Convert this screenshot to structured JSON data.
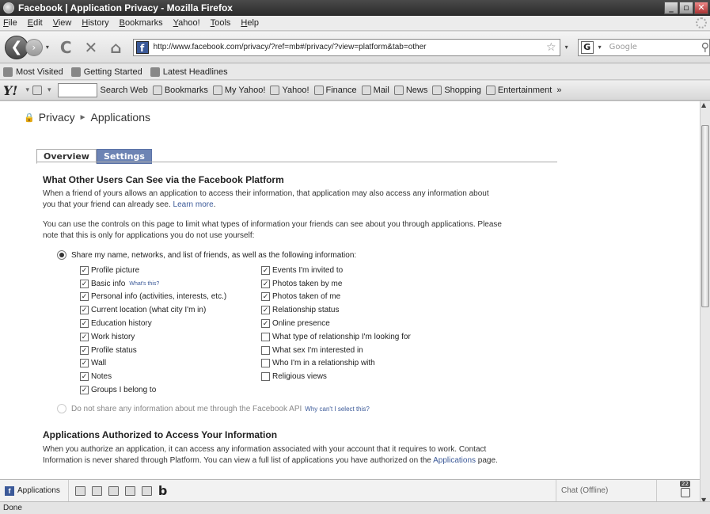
{
  "window": {
    "title": "Facebook | Application Privacy - Mozilla Firefox",
    "btn_min": "_",
    "btn_max": "▫",
    "btn_close": "✕"
  },
  "menu": [
    "File",
    "Edit",
    "View",
    "History",
    "Bookmarks",
    "Yahoo!",
    "Tools",
    "Help"
  ],
  "nav": {
    "url": "http://www.facebook.com/privacy/?ref=mb#/privacy/?view=platform&tab=other",
    "search_placeholder": "Google",
    "search_engine": "G",
    "fb_icon": "f",
    "back": "❮",
    "fwd": "›",
    "reload": "C",
    "stop": "✕",
    "home": "⌂",
    "star": "☆",
    "dropdown": "▾",
    "search_glass": "⚲"
  },
  "bookmarks": [
    "Most Visited",
    "Getting Started",
    "Latest Headlines"
  ],
  "yahoo": {
    "logo": "Y!",
    "search_web": "Search Web",
    "items": [
      "Bookmarks",
      "My Yahoo!",
      "Yahoo!",
      "Finance",
      "Mail",
      "News",
      "Shopping",
      "Entertainment"
    ],
    "more": "»"
  },
  "page": {
    "lock": "🔒",
    "breadcrumb": {
      "root": "Privacy",
      "sep": "►",
      "current": "Applications"
    },
    "tabs": [
      "Overview",
      "Settings"
    ],
    "section1": {
      "heading": "What Other Users Can See via the Facebook Platform",
      "para1": "When a friend of yours allows an application to access their information, that application may also access any information about you that your friend can already see.",
      "learn_more": "Learn more",
      "para2": "You can use the controls on this page to limit what types of information your friends can see about you through applications. Please note that this is only for applications you do not use yourself:",
      "share_label": "Share my name, networks, and list of friends, as well as the following information:",
      "left_options": [
        {
          "label": "Profile picture",
          "checked": true
        },
        {
          "label": "Basic info",
          "checked": true,
          "extra": "What's this?"
        },
        {
          "label": "Personal info (activities, interests, etc.)",
          "checked": true
        },
        {
          "label": "Current location (what city I'm in)",
          "checked": true
        },
        {
          "label": "Education history",
          "checked": true
        },
        {
          "label": "Work history",
          "checked": true
        },
        {
          "label": "Profile status",
          "checked": true
        },
        {
          "label": "Wall",
          "checked": true
        },
        {
          "label": "Notes",
          "checked": true
        },
        {
          "label": "Groups I belong to",
          "checked": true
        }
      ],
      "right_options": [
        {
          "label": "Events I'm invited to",
          "checked": true
        },
        {
          "label": "Photos taken by me",
          "checked": true
        },
        {
          "label": "Photos taken of me",
          "checked": true
        },
        {
          "label": "Relationship status",
          "checked": true
        },
        {
          "label": "Online presence",
          "checked": true
        },
        {
          "label": "What type of relationship I'm looking for",
          "checked": false
        },
        {
          "label": "What sex I'm interested in",
          "checked": false
        },
        {
          "label": "Who I'm in a relationship with",
          "checked": false
        },
        {
          "label": "Religious views",
          "checked": false
        }
      ],
      "no_share_label": "Do not share any information about me through the Facebook API",
      "why_cant": "Why can't I select this?"
    },
    "section2": {
      "heading": "Applications Authorized to Access Your Information",
      "para": "When you authorize an application, it can access any information associated with your account that it requires to work. Contact Information is never shared through Platform. You can view a full list of applications you have authorized on the",
      "link": "Applications",
      "para_end": "page."
    }
  },
  "fbbar": {
    "applications": "Applications",
    "chat": "Chat (Offline)",
    "notif_count": "22",
    "b": "b"
  },
  "status": "Done"
}
